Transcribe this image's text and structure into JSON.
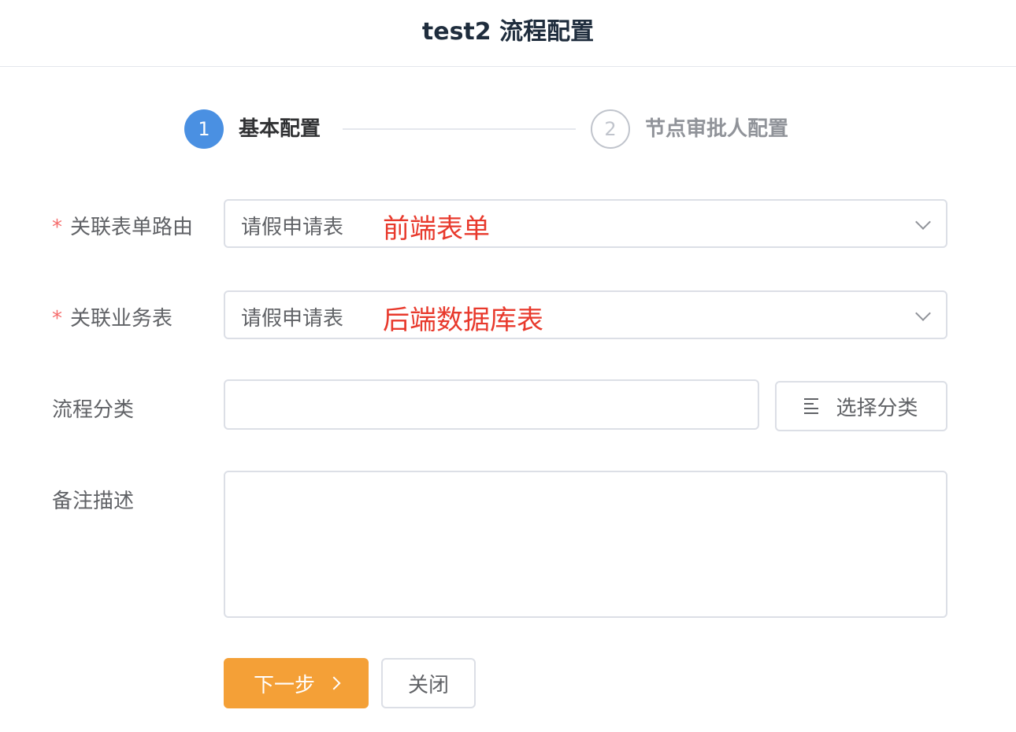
{
  "header": {
    "title": "test2 流程配置"
  },
  "steps": [
    {
      "number": "1",
      "title": "基本配置"
    },
    {
      "number": "2",
      "title": "节点审批人配置"
    }
  ],
  "form": {
    "required_mark": "*",
    "form_route": {
      "label": "关联表单路由",
      "value": "请假申请表",
      "annotation": "前端表单"
    },
    "business_table": {
      "label": "关联业务表",
      "value": "请假申请表",
      "annotation": "后端数据库表"
    },
    "category": {
      "label": "流程分类",
      "value": "",
      "button_label": "选择分类"
    },
    "remark": {
      "label": "备注描述",
      "value": ""
    }
  },
  "actions": {
    "next_label": "下一步",
    "close_label": "关闭"
  },
  "colors": {
    "primary": "#4a90e2",
    "warning_button": "#f4a037",
    "annotation": "#e8392c",
    "required": "#f56c6c"
  }
}
